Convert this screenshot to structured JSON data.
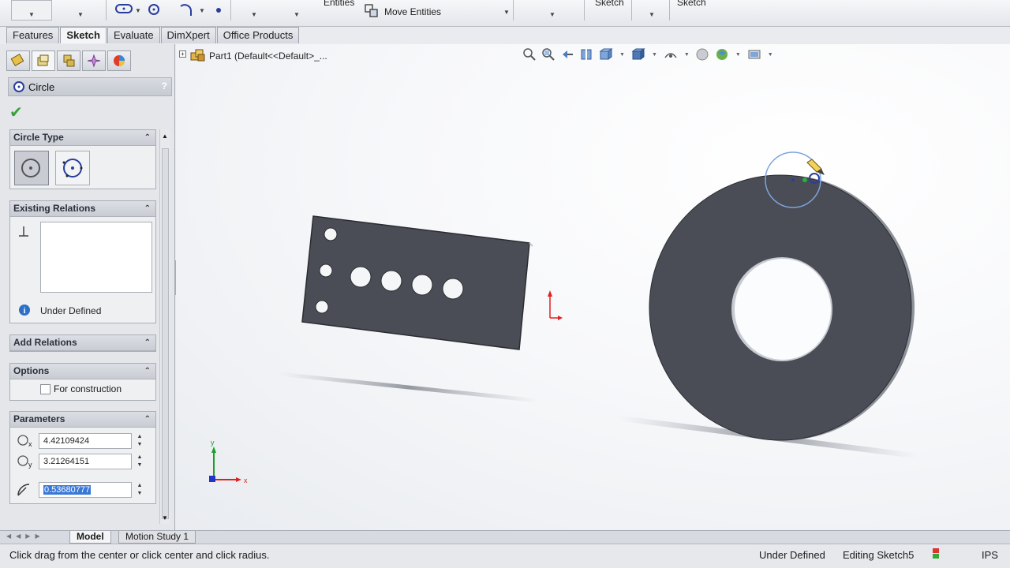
{
  "ribbon": {
    "entities_label": "Entities",
    "move_entities_label": "Move Entities",
    "sketch_label_1": "Sketch",
    "sketch_label_2": "Sketch"
  },
  "command_tabs": [
    "Features",
    "Sketch",
    "Evaluate",
    "DimXpert",
    "Office Products"
  ],
  "active_command_tab": "Sketch",
  "property_manager": {
    "title": "Circle",
    "help": "?",
    "groups": {
      "circle_type": "Circle Type",
      "existing_relations": "Existing Relations",
      "add_relations": "Add Relations",
      "options": "Options",
      "parameters": "Parameters"
    },
    "relation_status": "Under Defined",
    "for_construction_label": "For construction",
    "params": {
      "cx": "4.42109424",
      "cy": "3.21264151",
      "radius": "0.53680777"
    }
  },
  "viewport": {
    "feature_tree_label": "Part1  (Default<<Default>_..."
  },
  "bottom_tabs": [
    "Model",
    "Motion Study 1"
  ],
  "status_bar": {
    "hint": "Click drag from the center or click center and click radius.",
    "definition": "Under Defined",
    "editing": "Editing Sketch5",
    "units": "IPS"
  },
  "colors": {
    "part_fill": "#4a4d55",
    "sketch_circle": "#6e9bd8",
    "axis_x": "#e02020",
    "axis_y": "#1a9e2a",
    "axis_z": "#2035c8"
  }
}
